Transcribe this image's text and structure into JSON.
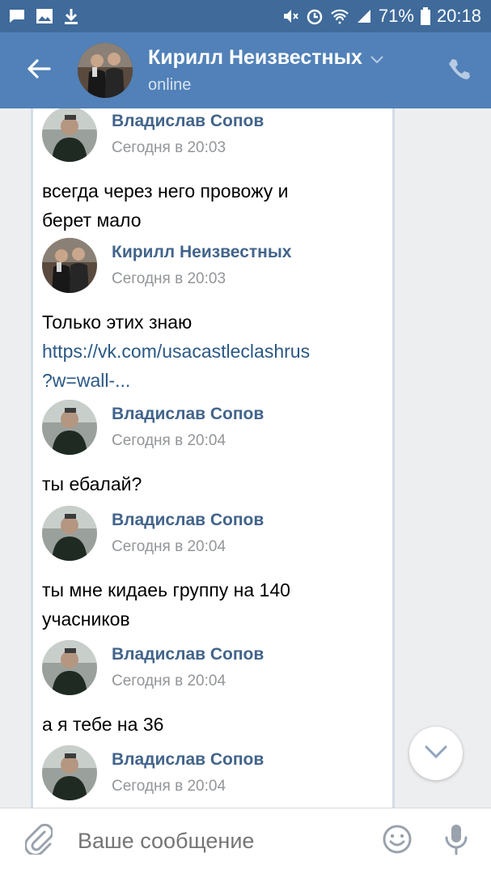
{
  "status_bar": {
    "battery": "71%",
    "time": "20:18",
    "icons": [
      "message-icon",
      "image-icon",
      "download-icon",
      "mute-icon",
      "alarm-icon",
      "wifi-icon",
      "signal-icon",
      "battery-icon"
    ]
  },
  "header": {
    "name": "Кирилл Неизвестных",
    "status": "online",
    "icons": [
      "back-arrow-icon",
      "chevron-down-icon",
      "phone-icon"
    ]
  },
  "messages": [
    {
      "author": "Владислав Сопов",
      "time": "Сегодня в 20:03",
      "lines": [
        "всегда через него провожу и",
        "берет мало"
      ]
    },
    {
      "author": "Кирилл Неизвестных",
      "time": "Сегодня в 20:03",
      "lines": [
        "Только этих знаю"
      ],
      "link_lines": [
        "https://vk.com/usacastleclashrus",
        "?w=wall-..."
      ]
    },
    {
      "author": "Владислав Сопов",
      "time": "Сегодня в 20:04",
      "lines": [
        "ты ебалай?"
      ]
    },
    {
      "author": "Владислав Сопов",
      "time": "Сегодня в 20:04",
      "lines": [
        "ты мне кидаеь группу на 140",
        "учасников"
      ]
    },
    {
      "author": "Владислав Сопов",
      "time": "Сегодня в 20:04",
      "lines": [
        "а я тебе на 36"
      ]
    },
    {
      "author": "Владислав Сопов",
      "time": "Сегодня в 20:04",
      "lines": []
    }
  ],
  "composer": {
    "placeholder": "Ваше сообщение",
    "icons": [
      "paperclip-icon",
      "smile-icon",
      "microphone-icon"
    ]
  },
  "colors": {
    "status_bar": "#3f6a9a",
    "header": "#5181b8",
    "author_name": "#42648b",
    "link": "#2a5885",
    "timestamp": "#939699"
  }
}
